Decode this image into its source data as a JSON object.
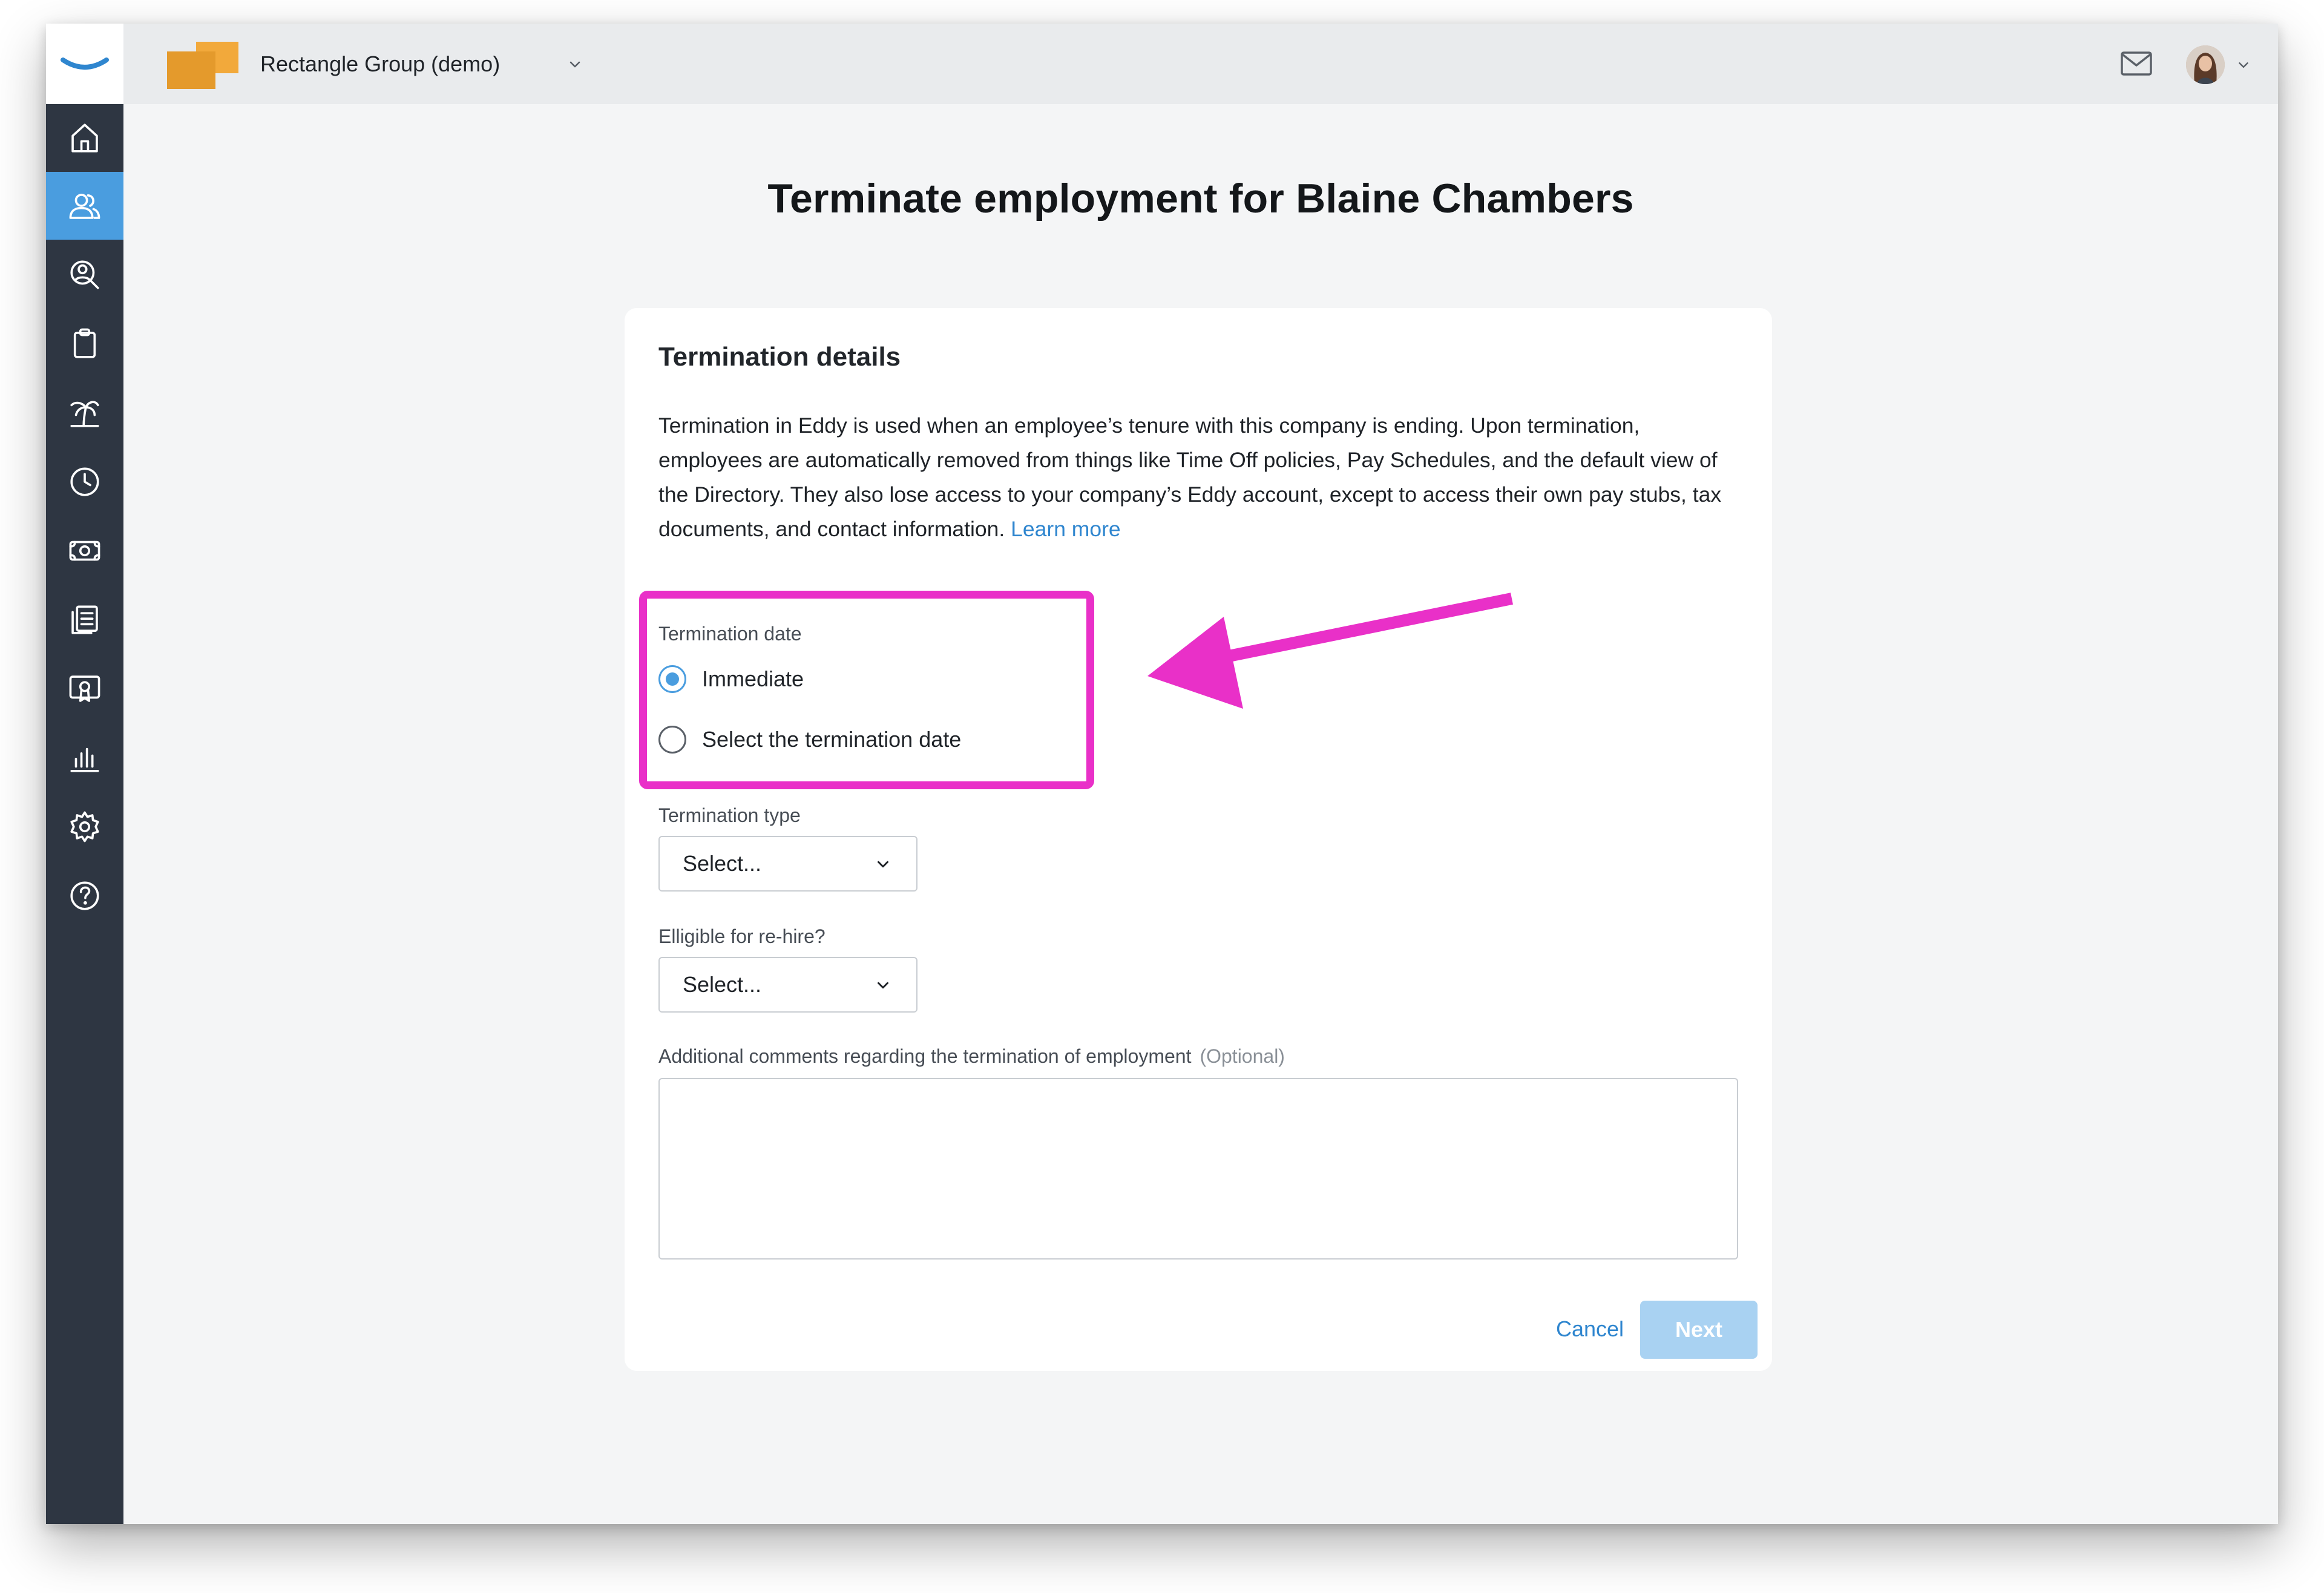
{
  "app": {
    "company_name": "Rectangle Group (demo)",
    "colors": {
      "sidebar": "#2e3642",
      "accent": "#4a9ddf",
      "link": "#2f86cf",
      "annotation": "#e930c8"
    }
  },
  "sidebar": {
    "items": [
      {
        "icon": "home-icon",
        "active": false
      },
      {
        "icon": "people-icon",
        "active": true
      },
      {
        "icon": "user-search-icon",
        "active": false
      },
      {
        "icon": "clipboard-icon",
        "active": false
      },
      {
        "icon": "palm-tree-icon",
        "active": false
      },
      {
        "icon": "clock-icon",
        "active": false
      },
      {
        "icon": "money-icon",
        "active": false
      },
      {
        "icon": "documents-icon",
        "active": false
      },
      {
        "icon": "certificate-icon",
        "active": false
      },
      {
        "icon": "bar-chart-icon",
        "active": false
      },
      {
        "icon": "gear-icon",
        "active": false
      },
      {
        "icon": "help-icon",
        "active": false
      }
    ]
  },
  "page": {
    "title": "Terminate employment for Blaine Chambers"
  },
  "form": {
    "section_title": "Termination details",
    "description": "Termination in Eddy is used when an employee’s tenure with this company is ending. Upon termination, employees are automatically removed from things like Time Off policies, Pay Schedules, and the default view of the Directory. They also lose access to your company’s Eddy account, except to access their own pay stubs, tax documents, and contact information.",
    "learn_more": "Learn more",
    "termination_date": {
      "label": "Termination date",
      "options": [
        "Immediate",
        "Select the termination date"
      ],
      "selected": "Immediate"
    },
    "termination_type": {
      "label": "Termination type",
      "value": "Select..."
    },
    "rehire": {
      "label": "Elligible for re-hire?",
      "value": "Select..."
    },
    "comments": {
      "label": "Additional comments regarding the termination of employment",
      "optional": "(Optional)",
      "value": ""
    },
    "cancel_label": "Cancel",
    "next_label": "Next"
  }
}
